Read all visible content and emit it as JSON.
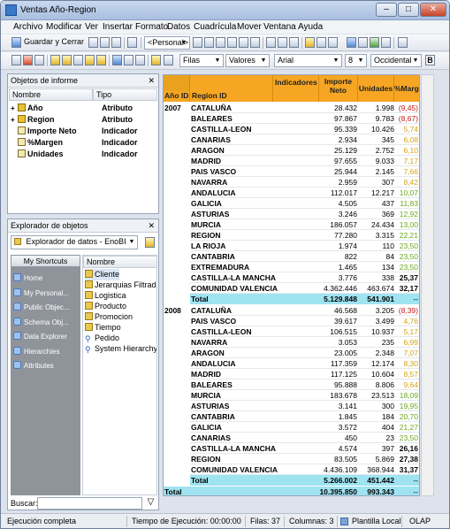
{
  "window": {
    "title": "Ventas Año-Region"
  },
  "menu": [
    "Archivo",
    "Modificar",
    "Ver",
    "Insertar",
    "Formato",
    "Datos",
    "Cuadrícula",
    "Mover",
    "Ventana",
    "Ayuda"
  ],
  "toolbar": {
    "save_close": "Guardar y Cerrar",
    "personal_combo": "<Personal>",
    "filas": "Filas",
    "valores": "Valores",
    "font": "Arial",
    "font_size": "8",
    "encoding": "Occidental",
    "bold": "B"
  },
  "report_objects": {
    "title": "Objetos de informe",
    "col_name": "Nombre",
    "col_type": "Tipo",
    "items": [
      {
        "name": "Año",
        "type": "Atributo",
        "expand": "+",
        "icon": "attribute-icon"
      },
      {
        "name": "Region",
        "type": "Atributo",
        "expand": "+",
        "icon": "attribute-icon"
      },
      {
        "name": "Importe Neto",
        "type": "Indicador",
        "expand": "",
        "icon": "metric-icon"
      },
      {
        "name": "%Margen",
        "type": "Indicador",
        "expand": "",
        "icon": "metric-icon"
      },
      {
        "name": "Unidades",
        "type": "Indicador",
        "expand": "",
        "icon": "metric-icon"
      }
    ]
  },
  "object_explorer": {
    "title": "Explorador de objetos",
    "combo": "Explorador de datos - EnoBI",
    "shortcuts_header": "My Shortcuts",
    "shortcuts": [
      "Home",
      "My Personal...",
      "Public Objec...",
      "Schema Obj...",
      "Data Explorer",
      "Hierarchies",
      "Attributes"
    ],
    "col_name": "Nombre",
    "items": [
      "Cliente",
      "Jerarquias Filtradas",
      "Logistica",
      "Producto",
      "Promocion",
      "Tiempo",
      "Pedido",
      "System Hierarchy"
    ],
    "search_label": "Buscar:"
  },
  "grid": {
    "headers": {
      "year": "Año ID",
      "region": "Region ID",
      "indicators": "Indicadores",
      "importe": "Importe Neto",
      "unidades": "Unidades",
      "margen": "%Margen"
    },
    "total_label": "Total",
    "colors": {
      "header": "#f6a623",
      "total": "#9fe3f1",
      "negative": "#c0201a",
      "positive": "#d6a516"
    },
    "blocks": [
      {
        "year": "2007",
        "rows": [
          {
            "region": "CATALUÑA",
            "importe": "28.432",
            "unidades": "1.998",
            "margen": "(9,45)",
            "tone": "neg"
          },
          {
            "region": "BALEARES",
            "importe": "97.867",
            "unidades": "9.783",
            "margen": "(8,67)",
            "tone": "neg"
          },
          {
            "region": "CASTILLA-LEON",
            "importe": "95.339",
            "unidades": "10.426",
            "margen": "5,74",
            "tone": "pos"
          },
          {
            "region": "CANARIAS",
            "importe": "2.934",
            "unidades": "345",
            "margen": "6,08",
            "tone": "pos"
          },
          {
            "region": "ARAGON",
            "importe": "25.129",
            "unidades": "2.752",
            "margen": "6,10",
            "tone": "pos"
          },
          {
            "region": "MADRID",
            "importe": "97.655",
            "unidades": "9.033",
            "margen": "7,17",
            "tone": "pos"
          },
          {
            "region": "PAIS VASCO",
            "importe": "25.944",
            "unidades": "2.145",
            "margen": "7,66",
            "tone": "pos"
          },
          {
            "region": "NAVARRA",
            "importe": "2.959",
            "unidades": "307",
            "margen": "8,42",
            "tone": "pos"
          },
          {
            "region": "ANDALUCIA",
            "importe": "112.017",
            "unidades": "12.217",
            "margen": "10,07",
            "tone": "grn"
          },
          {
            "region": "GALICIA",
            "importe": "4.505",
            "unidades": "437",
            "margen": "11,83",
            "tone": "grn"
          },
          {
            "region": "ASTURIAS",
            "importe": "3.246",
            "unidades": "369",
            "margen": "12,92",
            "tone": "grn"
          },
          {
            "region": "MURCIA",
            "importe": "186.057",
            "unidades": "24.434",
            "margen": "13,00",
            "tone": "grn"
          },
          {
            "region": "REGION",
            "importe": "77.280",
            "unidades": "3.315",
            "margen": "22,21",
            "tone": "grn"
          },
          {
            "region": "LA RIOJA",
            "importe": "1.974",
            "unidades": "110",
            "margen": "23,50",
            "tone": "grn"
          },
          {
            "region": "CANTABRIA",
            "importe": "822",
            "unidades": "84",
            "margen": "23,50",
            "tone": "grn"
          },
          {
            "region": "EXTREMADURA",
            "importe": "1.465",
            "unidades": "134",
            "margen": "23,50",
            "tone": "grn"
          },
          {
            "region": "CASTILLA-LA MANCHA",
            "importe": "3.776",
            "unidades": "338",
            "margen": "25,37",
            "tone": "bold"
          },
          {
            "region": "COMUNIDAD VALENCIA",
            "importe": "4.362.446",
            "unidades": "463.674",
            "margen": "32,17",
            "tone": "bold"
          }
        ],
        "total": {
          "importe": "5.129.848",
          "unidades": "541.901",
          "margen": "--"
        }
      },
      {
        "year": "2008",
        "rows": [
          {
            "region": "CATALUÑA",
            "importe": "46.568",
            "unidades": "3.205",
            "margen": "(8,39)",
            "tone": "neg"
          },
          {
            "region": "PAIS VASCO",
            "importe": "39.617",
            "unidades": "3.499",
            "margen": "4,76",
            "tone": "pos"
          },
          {
            "region": "CASTILLA-LEON",
            "importe": "106.515",
            "unidades": "10.937",
            "margen": "5,17",
            "tone": "pos"
          },
          {
            "region": "NAVARRA",
            "importe": "3.053",
            "unidades": "235",
            "margen": "6,99",
            "tone": "pos"
          },
          {
            "region": "ARAGON",
            "importe": "23.005",
            "unidades": "2.348",
            "margen": "7,07",
            "tone": "pos"
          },
          {
            "region": "ANDALUCIA",
            "importe": "117.359",
            "unidades": "12.174",
            "margen": "8,30",
            "tone": "pos"
          },
          {
            "region": "MADRID",
            "importe": "117.125",
            "unidades": "10.604",
            "margen": "8,57",
            "tone": "pos"
          },
          {
            "region": "BALEARES",
            "importe": "95.888",
            "unidades": "8.806",
            "margen": "9,64",
            "tone": "pos"
          },
          {
            "region": "MURCIA",
            "importe": "183.678",
            "unidades": "23.513",
            "margen": "18,09",
            "tone": "grn"
          },
          {
            "region": "ASTURIAS",
            "importe": "3.141",
            "unidades": "300",
            "margen": "19,95",
            "tone": "grn"
          },
          {
            "region": "CANTABRIA",
            "importe": "1.845",
            "unidades": "184",
            "margen": "20,70",
            "tone": "grn"
          },
          {
            "region": "GALICIA",
            "importe": "3.572",
            "unidades": "404",
            "margen": "21,27",
            "tone": "grn"
          },
          {
            "region": "CANARIAS",
            "importe": "450",
            "unidades": "23",
            "margen": "23,50",
            "tone": "grn"
          },
          {
            "region": "CASTILLA-LA MANCHA",
            "importe": "4.574",
            "unidades": "397",
            "margen": "26,16",
            "tone": "bold"
          },
          {
            "region": "REGION",
            "importe": "83.505",
            "unidades": "5.869",
            "margen": "27,38",
            "tone": "bold"
          },
          {
            "region": "COMUNIDAD VALENCIA",
            "importe": "4.436.109",
            "unidades": "368.944",
            "margen": "31,37",
            "tone": "bold"
          }
        ],
        "total": {
          "importe": "5.266.002",
          "unidades": "451.442",
          "margen": "--"
        }
      }
    ],
    "grand_total": {
      "label": "Total",
      "importe": "10.395.850",
      "unidades": "993.343",
      "margen": "--"
    }
  },
  "status": {
    "state": "Ejecución completa",
    "exec_time": "Tiempo de Ejecución: 00:00:00",
    "rows": "Filas: 37",
    "columns": "Columnas: 3",
    "template": "Plantilla Local",
    "mode": "OLAP"
  }
}
